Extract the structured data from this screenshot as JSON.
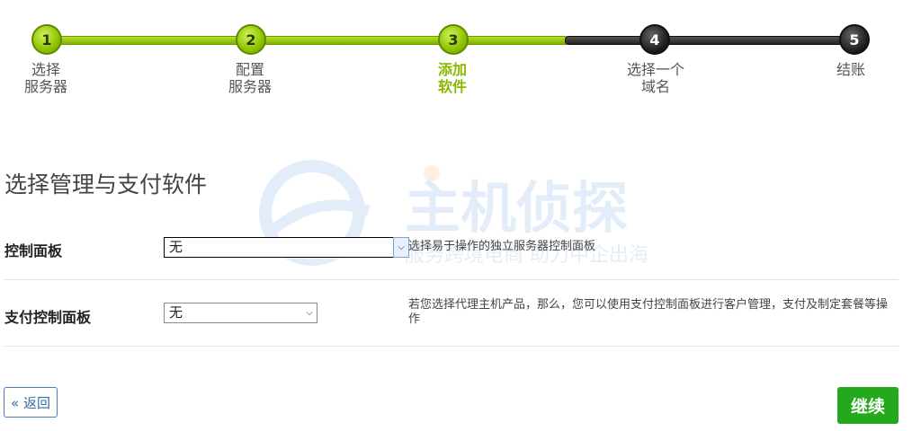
{
  "stepper": {
    "steps": [
      {
        "number": "1",
        "label": "选择\n服务器"
      },
      {
        "number": "2",
        "label": "配置\n服务器"
      },
      {
        "number": "3",
        "label": "添加\n软件"
      },
      {
        "number": "4",
        "label": "选择一个\n域名"
      },
      {
        "number": "5",
        "label": "结账"
      }
    ],
    "current_step": 3
  },
  "section": {
    "title": "选择管理与支付软件"
  },
  "control_panel": {
    "label": "控制面板",
    "value": "无",
    "help": "选择易于操作的独立服务器控制面板"
  },
  "billing_panel": {
    "label": "支付控制面板",
    "value": "无",
    "help": "若您选择代理主机产品，那么，您可以使用支付控制面板进行客户管理，支付及制定套餐等操作"
  },
  "actions": {
    "back_label": "« 返回",
    "continue_label": "继续"
  },
  "colors": {
    "progress_done": "#8cc300",
    "progress_todo": "#222222",
    "continue_button": "#23a91b",
    "back_button_border": "#4a79b4"
  },
  "watermark": {
    "text": "主机侦探",
    "subtext": "服务跨境电商 助力中企出海"
  }
}
